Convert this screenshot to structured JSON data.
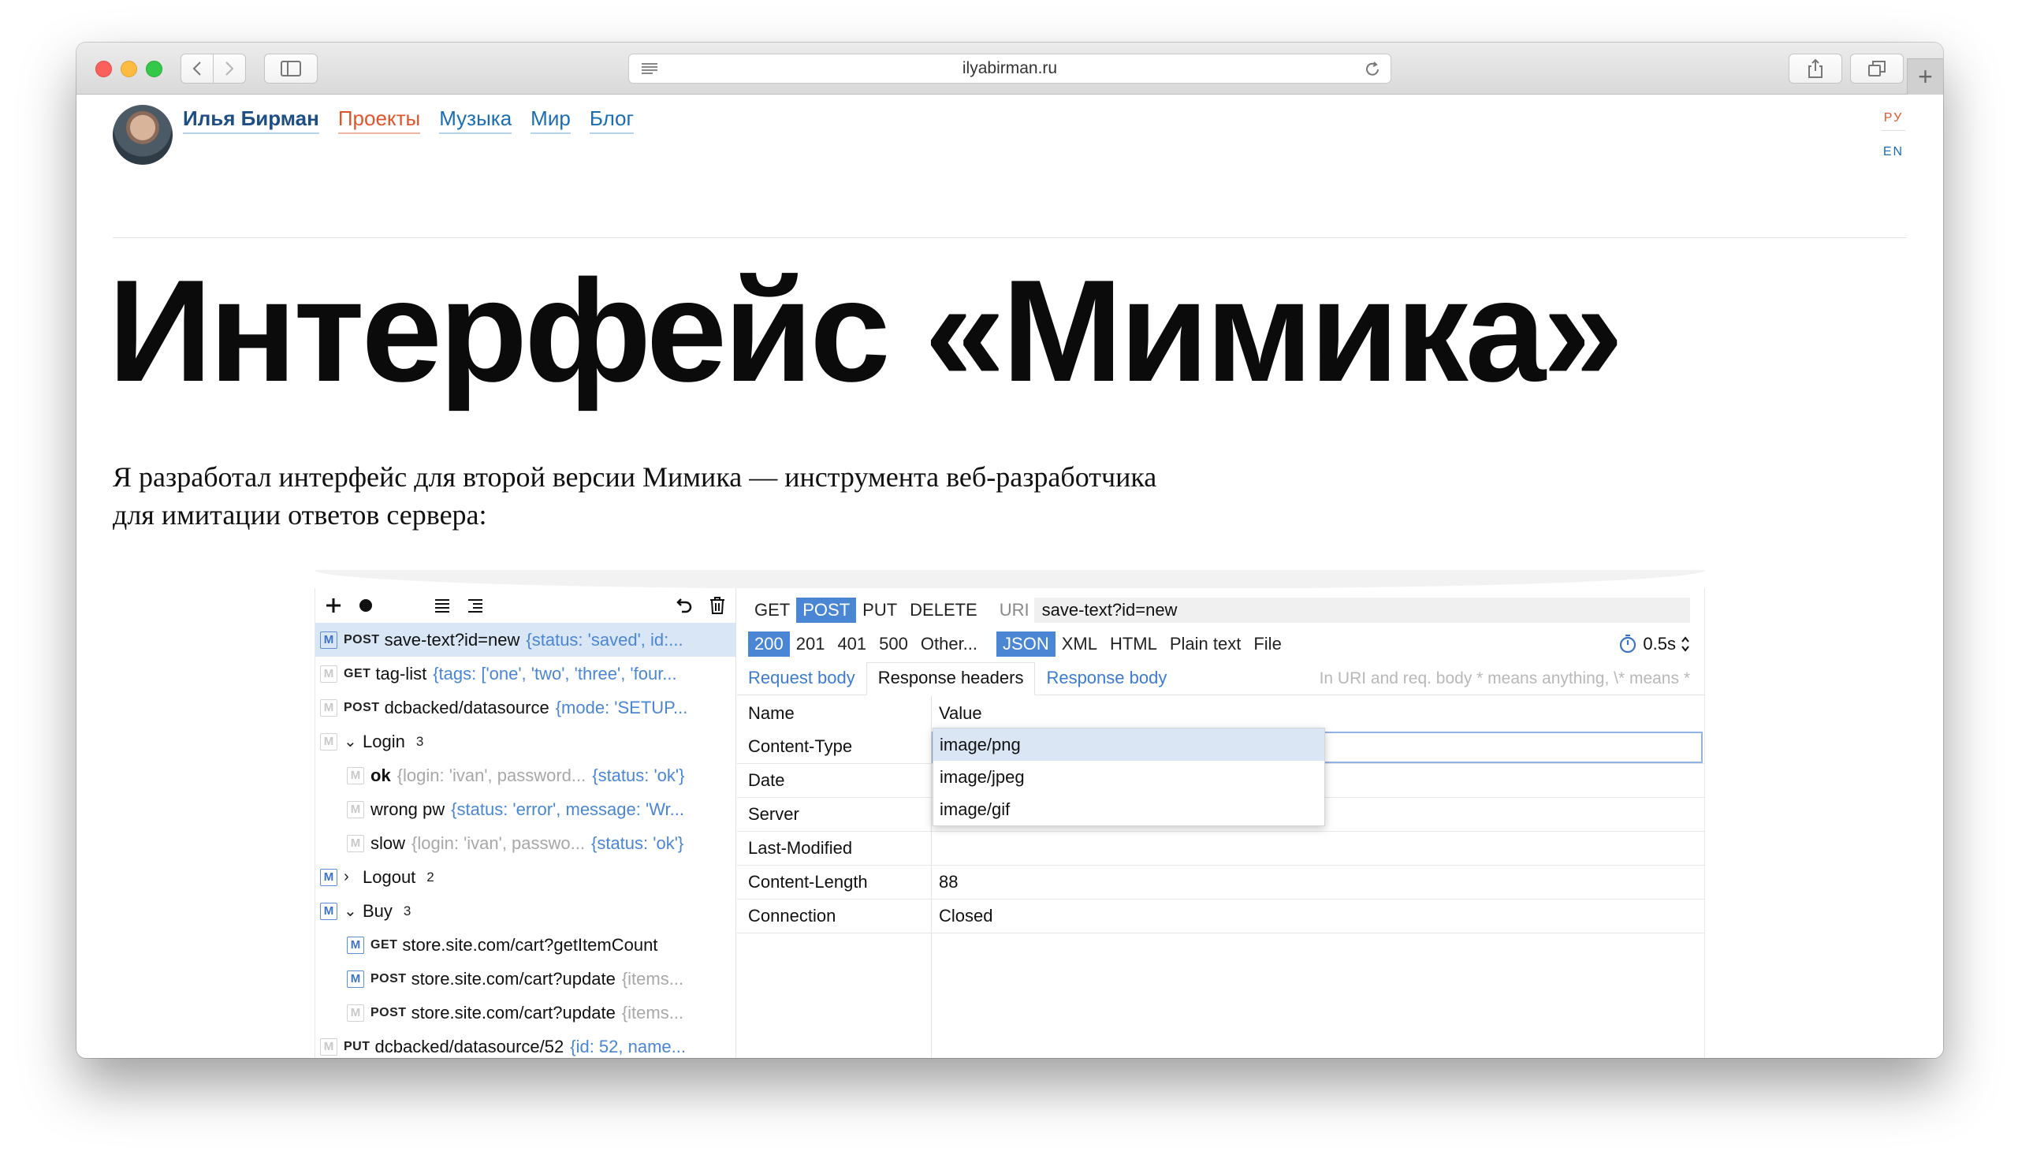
{
  "browser": {
    "address": "ilyabirman.ru",
    "new_tab_symbol": "+"
  },
  "site": {
    "nav": {
      "home": "Илья Бирман",
      "projects": "Проекты",
      "music": "Музыка",
      "world": "Мир",
      "blog": "Блог"
    },
    "lang": {
      "ru": "РУ",
      "en": "EN"
    },
    "title": "Интерфейс «Мимика»",
    "intro_line1": "Я разработал интерфейс для второй версии Мимика — инструмента веб-разработчика",
    "intro_line2": "для имитации ответов сервера:"
  },
  "app": {
    "requests": [
      {
        "badge": "M",
        "method": "POST",
        "name": "save-text?id=new",
        "meta": "{status: 'saved', id:...",
        "selected": true
      },
      {
        "badge": "M",
        "method": "GET",
        "name": "tag-list",
        "meta": "{tags: ['one', 'two', 'three', 'four..."
      },
      {
        "badge": "M",
        "method": "POST",
        "name": "dcbacked/datasource",
        "meta": "{mode: 'SETUP..."
      },
      {
        "group": "Login",
        "count": "3"
      },
      {
        "name": "ok",
        "meta_grey": "{login: 'ivan', password...",
        "meta": "{status: 'ok'}"
      },
      {
        "name": "wrong pw",
        "meta": "{status: 'error', message: 'Wr..."
      },
      {
        "name": "slow",
        "meta_grey": "{login: 'ivan', passwo...",
        "meta": "{status: 'ok'}"
      },
      {
        "group": "Logout",
        "count": "2"
      },
      {
        "group": "Buy",
        "count": "3"
      },
      {
        "badge": "M",
        "method": "GET",
        "name": "store.site.com/cart?getItemCount"
      },
      {
        "badge": "M",
        "method": "POST",
        "name": "store.site.com/cart?update",
        "meta_grey": "{items..."
      },
      {
        "badge": "M",
        "method": "POST",
        "name": "store.site.com/cart?update",
        "meta_grey": "{items..."
      },
      {
        "badge": "M",
        "method": "PUT",
        "name": "dcbacked/datasource/52",
        "meta": "{id: 52, name..."
      }
    ],
    "methods": [
      "GET",
      "POST",
      "PUT",
      "DELETE"
    ],
    "active_method": "POST",
    "uri_label": "URI",
    "uri_value": "save-text?id=new",
    "status_codes": [
      "200",
      "201",
      "401",
      "500",
      "Other..."
    ],
    "formats": [
      "JSON",
      "XML",
      "HTML",
      "Plain text",
      "File"
    ],
    "delay": "0.5s",
    "tabs": [
      "Request body",
      "Response headers",
      "Response body"
    ],
    "tab_hint": "In URI and req. body * means anything, \\* means *",
    "headers_head": {
      "name": "Name",
      "value": "Value"
    },
    "headers": [
      {
        "name": "Content-Type",
        "value": "image/png"
      },
      {
        "name": "Date",
        "value": ""
      },
      {
        "name": "Server",
        "value": ""
      },
      {
        "name": "Last-Modified",
        "value": ""
      },
      {
        "name": "Content-Length",
        "value": "88"
      },
      {
        "name": "Connection",
        "value": "Closed"
      }
    ],
    "dropdown": [
      "image/png",
      "image/jpeg",
      "image/gif"
    ]
  }
}
